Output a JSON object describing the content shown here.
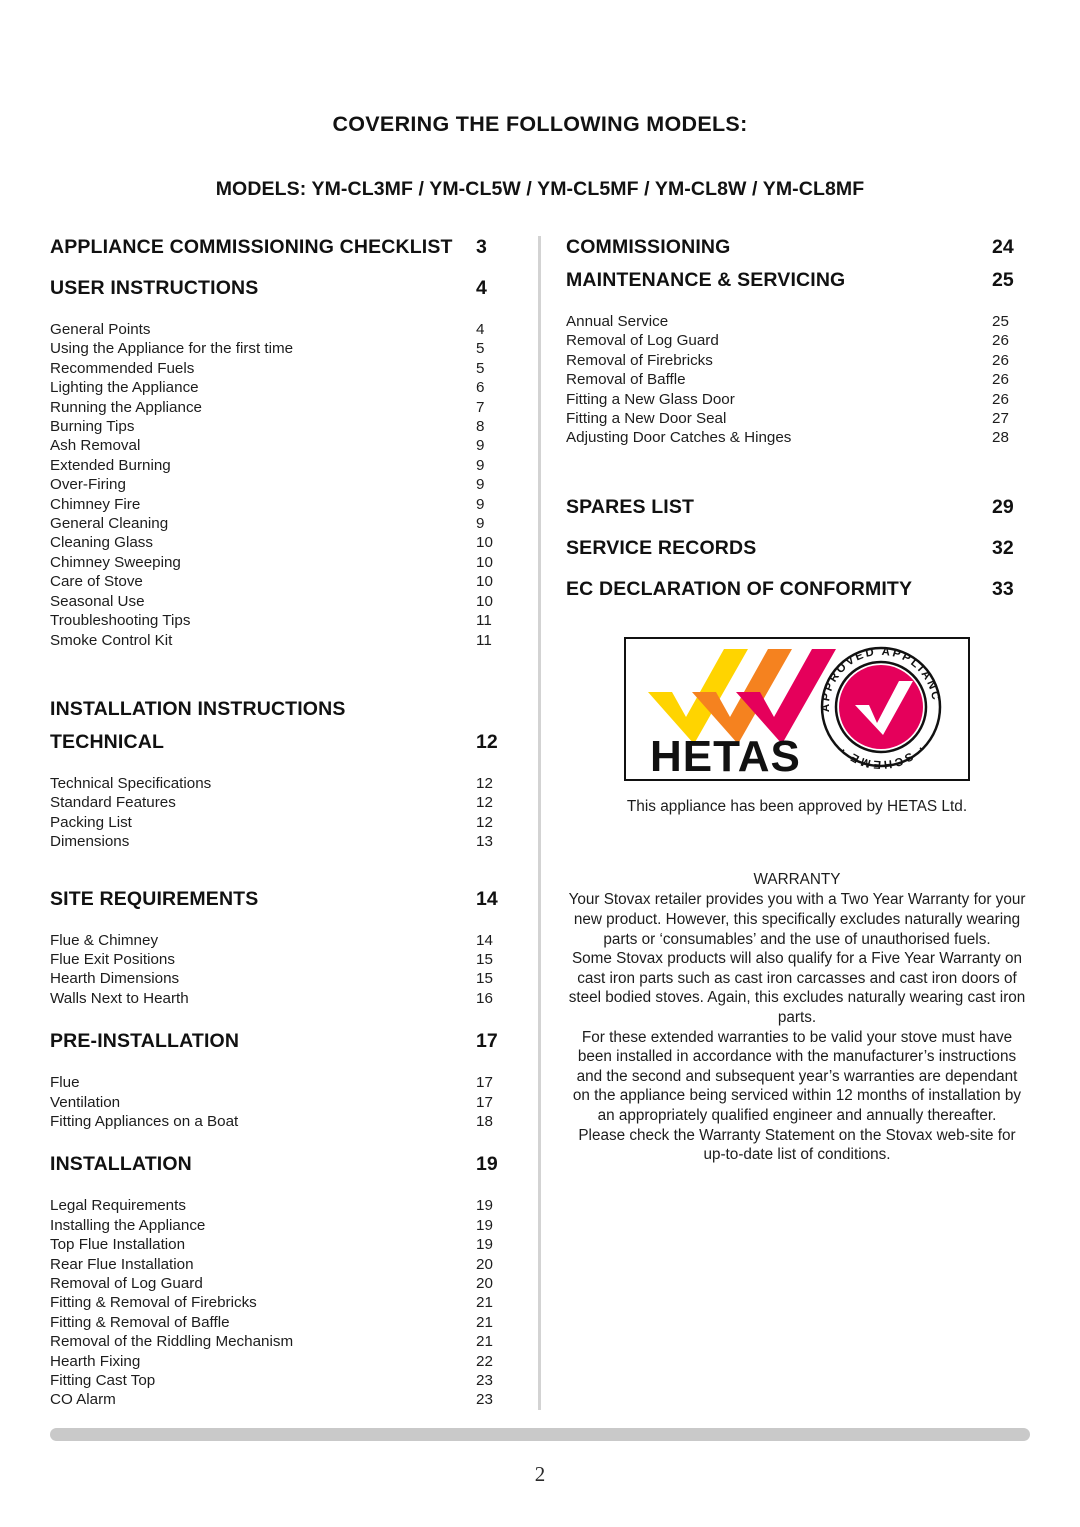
{
  "header": {
    "cover_title": "COVERING THE FOLLOWING MODELS:",
    "models_line": "MODELS: YM-CL3MF / YM-CL5W / YM-CL5MF / YM-CL8W / YM-CL8MF"
  },
  "left_column": {
    "headings": {
      "appliance_checklist": {
        "label": "APPLIANCE COMMISSIONING CHECKLIST",
        "page": "3"
      },
      "user_instructions": {
        "label": "USER INSTRUCTIONS",
        "page": "4"
      },
      "installation_instructions": {
        "label": "INSTALLATION INSTRUCTIONS",
        "page": ""
      },
      "technical": {
        "label": "TECHNICAL",
        "page": "12"
      },
      "site_requirements": {
        "label": "SITE REQUIREMENTS",
        "page": "14"
      },
      "pre_installation": {
        "label": "PRE-INSTALLATION",
        "page": "17"
      },
      "installation": {
        "label": "INSTALLATION",
        "page": "19"
      }
    },
    "user_instructions_entries": [
      {
        "label": "General Points",
        "page": "4"
      },
      {
        "label": "Using the Appliance for the first time",
        "page": "5"
      },
      {
        "label": "Recommended Fuels",
        "page": "5"
      },
      {
        "label": "Lighting the Appliance",
        "page": "6"
      },
      {
        "label": "Running the Appliance",
        "page": "7"
      },
      {
        "label": "Burning Tips",
        "page": "8"
      },
      {
        "label": "Ash Removal",
        "page": "9"
      },
      {
        "label": "Extended Burning",
        "page": "9"
      },
      {
        "label": "Over-Firing",
        "page": "9"
      },
      {
        "label": "Chimney Fire",
        "page": "9"
      },
      {
        "label": "General Cleaning",
        "page": "9"
      },
      {
        "label": "Cleaning Glass",
        "page": "10"
      },
      {
        "label": "Chimney Sweeping",
        "page": "10"
      },
      {
        "label": "Care of Stove",
        "page": "10"
      },
      {
        "label": "Seasonal Use",
        "page": "10"
      },
      {
        "label": "Troubleshooting Tips",
        "page": "11"
      },
      {
        "label": "Smoke Control Kit",
        "page": "11"
      }
    ],
    "technical_entries": [
      {
        "label": "Technical Specifications",
        "page": "12"
      },
      {
        "label": "Standard Features",
        "page": "12"
      },
      {
        "label": "Packing List",
        "page": "12"
      },
      {
        "label": "Dimensions",
        "page": "13"
      }
    ],
    "site_requirements_entries": [
      {
        "label": "Flue & Chimney",
        "page": "14"
      },
      {
        "label": "Flue Exit Positions",
        "page": "15"
      },
      {
        "label": "Hearth Dimensions",
        "page": "15"
      },
      {
        "label": "Walls Next to Hearth",
        "page": "16"
      }
    ],
    "pre_installation_entries": [
      {
        "label": "Flue",
        "page": "17"
      },
      {
        "label": "Ventilation",
        "page": "17"
      },
      {
        "label": "Fitting Appliances on a Boat",
        "page": "18"
      }
    ],
    "installation_entries": [
      {
        "label": "Legal Requirements",
        "page": "19"
      },
      {
        "label": "Installing the Appliance",
        "page": "19"
      },
      {
        "label": "Top Flue Installation",
        "page": "19"
      },
      {
        "label": "Rear Flue Installation",
        "page": "20"
      },
      {
        "label": "Removal of Log Guard",
        "page": "20"
      },
      {
        "label": "Fitting & Removal of Firebricks",
        "page": "21"
      },
      {
        "label": "Fitting & Removal of Baffle",
        "page": "21"
      },
      {
        "label": "Removal of the Riddling Mechanism",
        "page": "21"
      },
      {
        "label": "Hearth Fixing",
        "page": "22"
      },
      {
        "label": "Fitting Cast Top",
        "page": "23"
      },
      {
        "label": "CO Alarm",
        "page": "23"
      }
    ]
  },
  "right_column": {
    "headings": {
      "commissioning": {
        "label": "COMMISSIONING",
        "page": "24"
      },
      "maintenance_servicing": {
        "label": "MAINTENANCE & SERVICING",
        "page": "25"
      },
      "spares_list": {
        "label": "SPARES LIST",
        "page": "29"
      },
      "service_records": {
        "label": "SERVICE RECORDS",
        "page": "32"
      },
      "ec_declaration": {
        "label": "EC DECLARATION OF CONFORMITY",
        "page": "33"
      }
    },
    "maintenance_entries": [
      {
        "label": "Annual Service",
        "page": "25"
      },
      {
        "label": "Removal of Log Guard",
        "page": "26"
      },
      {
        "label": "Removal of Firebricks",
        "page": "26"
      },
      {
        "label": "Removal of Baffle",
        "page": "26"
      },
      {
        "label": "Fitting a New Glass Door",
        "page": "26"
      },
      {
        "label": "Fitting a New Door Seal",
        "page": "27"
      },
      {
        "label": "Adjusting Door Catches & Hinges",
        "page": "28"
      }
    ],
    "hetas": {
      "wordmark": "HETAS",
      "seal_top_text": "APPROVED APPLIANCE",
      "seal_bottom_text": "SCHEME",
      "caption": "This appliance has been approved by HETAS Ltd.",
      "colors": {
        "yellow": "#FFD400",
        "orange": "#F5821F",
        "magenta": "#E5005B",
        "black": "#111111"
      }
    },
    "warranty": {
      "title": "WARRANTY",
      "paragraphs": [
        "Your Stovax retailer provides you with a Two Year Warranty for your new product. However, this specifically excludes naturally wearing parts or ‘consumables’ and the use of unauthorised fuels.",
        "Some Stovax products will also qualify for a Five Year Warranty on cast iron parts such as cast iron carcasses and cast iron doors of steel bodied stoves. Again, this excludes naturally wearing cast iron parts.",
        "For these extended warranties to be valid your stove must have been installed in accordance with the manufacturer’s instructions and the second and subsequent year’s warranties are dependant on the appliance being serviced within 12 months of installation by an appropriately qualified engineer and annually thereafter.",
        "Please check the Warranty Statement on the Stovax web-site for up-to-date list of conditions."
      ]
    }
  },
  "footer": {
    "page_number": "2"
  }
}
